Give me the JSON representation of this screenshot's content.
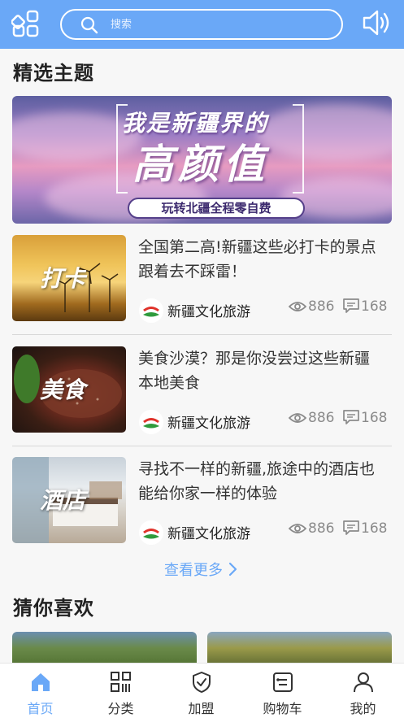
{
  "colors": {
    "accent": "#6aa8f7",
    "text": "#333333",
    "muted": "#8a8a8a"
  },
  "header": {
    "search_placeholder": "搜索",
    "menu_icon": "grid-icon",
    "sound_icon": "speaker-icon"
  },
  "featured": {
    "title": "精选主题",
    "banner": {
      "line1": "我是新疆界的",
      "line2": "高颜值",
      "tagline": "玩转北疆全程零自费"
    }
  },
  "articles": [
    {
      "thumb_label": "打卡",
      "title": "全国第二高!新疆这些必打卡的景点跟着去不踩雷！",
      "author": "新疆文化旅游",
      "views": "886",
      "comments": "168"
    },
    {
      "thumb_label": "美食",
      "title": "美食沙漠？那是你没尝过这些新疆 本地美食",
      "author": "新疆文化旅游",
      "views": "886",
      "comments": "168"
    },
    {
      "thumb_label": "酒店",
      "title": "寻找不一样的新疆,旅途中的酒店也能给你家一样的体验",
      "author": "新疆文化旅游",
      "views": "886",
      "comments": "168"
    }
  ],
  "more_label": "查看更多",
  "recommend": {
    "title": "猜你喜欢"
  },
  "tabs": [
    {
      "label": "首页",
      "icon": "home-icon",
      "active": true
    },
    {
      "label": "分类",
      "icon": "category-icon",
      "active": false
    },
    {
      "label": "加盟",
      "icon": "shield-icon",
      "active": false
    },
    {
      "label": "购物车",
      "icon": "cart-icon",
      "active": false
    },
    {
      "label": "我的",
      "icon": "user-icon",
      "active": false
    }
  ]
}
